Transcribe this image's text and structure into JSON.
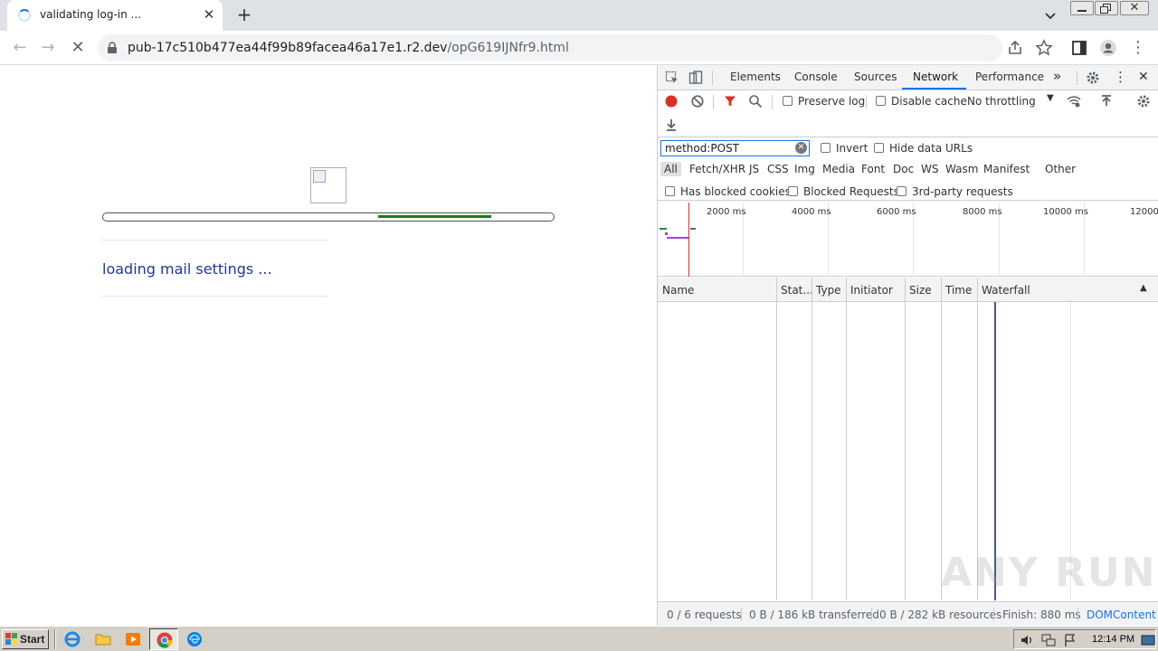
{
  "browser": {
    "tab_title": "validating log-in ...",
    "url_host": "pub-17c510b477ea44f99b89facea46a17e1.r2.dev",
    "url_path": "/opG619IJNfr9.html"
  },
  "page": {
    "loading_text": "loading mail settings ...",
    "progress": {
      "start": 0.61,
      "end": 0.86
    }
  },
  "devtools": {
    "tabs": [
      "Elements",
      "Console",
      "Sources",
      "Network",
      "Performance"
    ],
    "active_tab": "Network",
    "preserve_log": "Preserve log",
    "disable_cache": "Disable cache",
    "throttling": "No throttling",
    "filter_value": "method:POST",
    "invert": "Invert",
    "hide_data_urls": "Hide data URLs",
    "types": [
      "All",
      "Fetch/XHR",
      "JS",
      "CSS",
      "Img",
      "Media",
      "Font",
      "Doc",
      "WS",
      "Wasm",
      "Manifest",
      "Other"
    ],
    "has_blocked_cookies": "Has blocked cookies",
    "blocked_requests": "Blocked Requests",
    "third_party": "3rd-party requests",
    "overview_ticks": [
      "2000 ms",
      "4000 ms",
      "6000 ms",
      "8000 ms",
      "10000 ms",
      "12000"
    ],
    "columns": [
      "Name",
      "Stat...",
      "Type",
      "Initiator",
      "Size",
      "Time",
      "Waterfall"
    ],
    "status": {
      "requests": "0 / 6 requests",
      "transferred": "0 B / 186 kB transferred",
      "resources": "0 B / 282 kB resources",
      "finish": "Finish: 880 ms",
      "dom": "DOMContentL"
    }
  },
  "watermark": "ANY RUN",
  "taskbar": {
    "start_label": "Start",
    "clock": "12:14 PM"
  },
  "colors": {
    "accent": "#1a73e8",
    "progress_fill": "#1e7a1e",
    "loading_text": "#1f3a93",
    "record_red": "#d93025"
  }
}
